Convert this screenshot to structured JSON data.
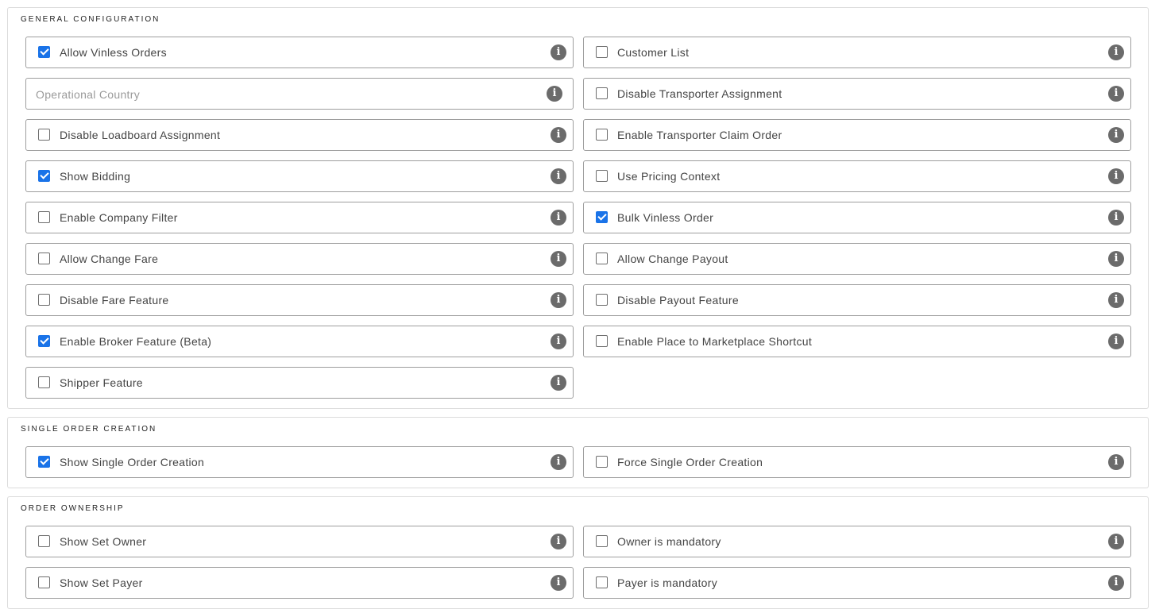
{
  "sections": {
    "general": {
      "title": "GENERAL CONFIGURATION",
      "allow_vinless_orders": {
        "label": "Allow Vinless Orders",
        "checked": true
      },
      "customer_list": {
        "label": "Customer List",
        "checked": false
      },
      "operational_country": {
        "placeholder": "Operational Country",
        "value": ""
      },
      "disable_transporter_assignment": {
        "label": "Disable Transporter Assignment",
        "checked": false
      },
      "disable_loadboard_assignment": {
        "label": "Disable Loadboard Assignment",
        "checked": false
      },
      "enable_transporter_claim_order": {
        "label": "Enable Transporter Claim Order",
        "checked": false
      },
      "show_bidding": {
        "label": "Show Bidding",
        "checked": true
      },
      "use_pricing_context": {
        "label": "Use Pricing Context",
        "checked": false
      },
      "enable_company_filter": {
        "label": "Enable Company Filter",
        "checked": false
      },
      "bulk_vinless_order": {
        "label": "Bulk Vinless Order",
        "checked": true
      },
      "allow_change_fare": {
        "label": "Allow Change Fare",
        "checked": false
      },
      "allow_change_payout": {
        "label": "Allow Change Payout",
        "checked": false
      },
      "disable_fare_feature": {
        "label": "Disable Fare Feature",
        "checked": false
      },
      "disable_payout_feature": {
        "label": "Disable Payout Feature",
        "checked": false
      },
      "enable_broker_feature": {
        "label": "Enable Broker Feature (Beta)",
        "checked": true
      },
      "enable_place_to_marketplace_shortcut": {
        "label": "Enable Place to Marketplace Shortcut",
        "checked": false
      },
      "shipper_feature": {
        "label": "Shipper Feature",
        "checked": false
      }
    },
    "single_order": {
      "title": "SINGLE ORDER CREATION",
      "show_single_order_creation": {
        "label": "Show Single Order Creation",
        "checked": true
      },
      "force_single_order_creation": {
        "label": "Force Single Order Creation",
        "checked": false
      }
    },
    "ownership": {
      "title": "ORDER OWNERSHIP",
      "show_set_owner": {
        "label": "Show Set Owner",
        "checked": false
      },
      "owner_is_mandatory": {
        "label": "Owner is mandatory",
        "checked": false
      },
      "show_set_payer": {
        "label": "Show Set Payer",
        "checked": false
      },
      "payer_is_mandatory": {
        "label": "Payer is mandatory",
        "checked": false
      }
    }
  },
  "icons": {
    "info": "info-icon",
    "info_glyph": "i"
  },
  "colors": {
    "checkbox_checked": "#1a73e8",
    "info_icon": "#6b6b6b",
    "field_border": "#9e9e9e"
  }
}
